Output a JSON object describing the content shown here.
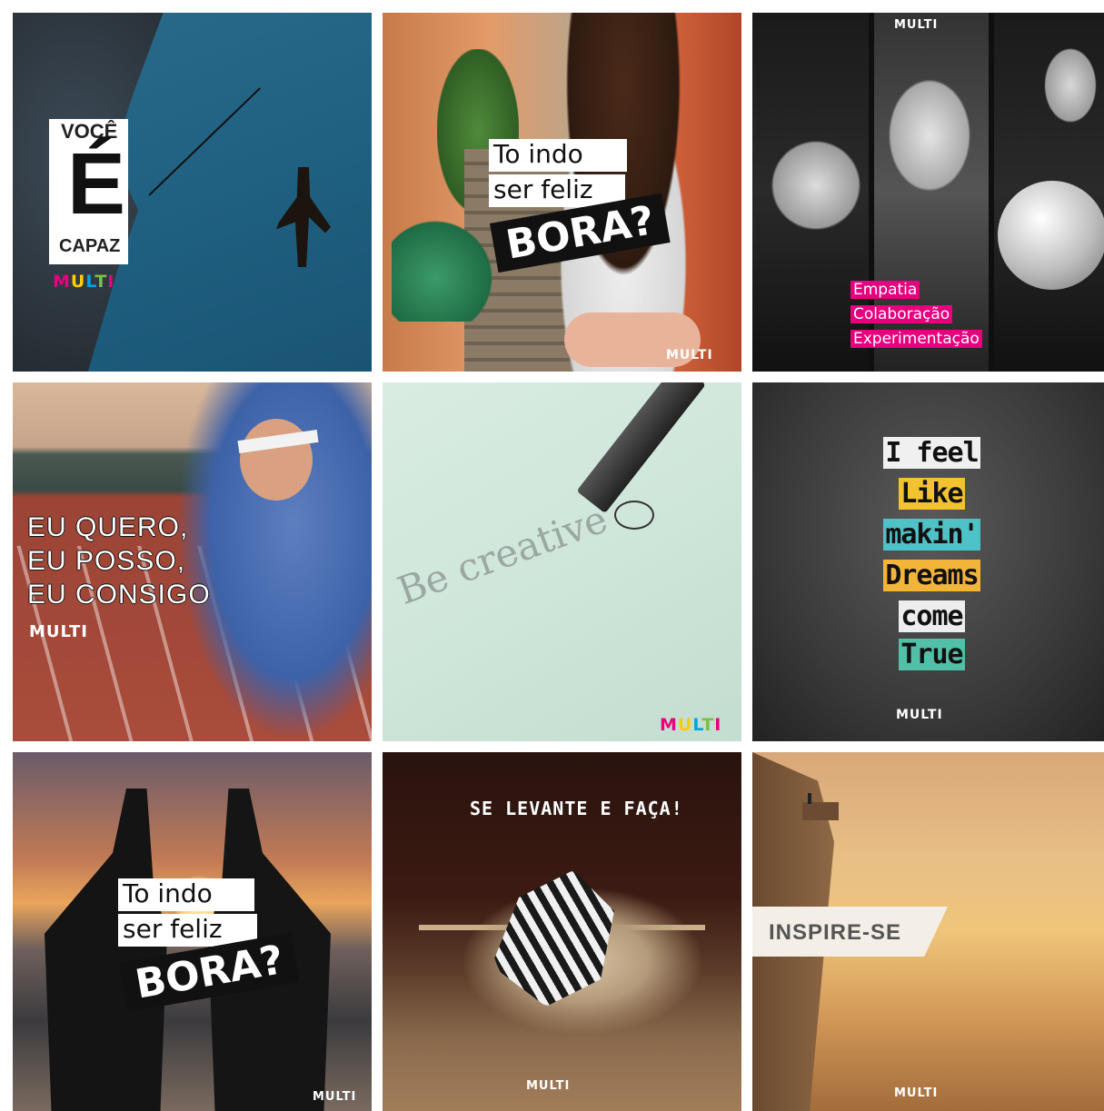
{
  "tiles": [
    {
      "id": "voce-e-capaz",
      "line1": "VOCÊ",
      "big": "É",
      "line2": "CAPAZ",
      "logo": "MULTI"
    },
    {
      "id": "to-indo-street",
      "line1": "To indo",
      "line2": "ser feliz",
      "cta": "BORA?",
      "logo": "MULTI"
    },
    {
      "id": "hands",
      "tags": [
        "Empatia",
        "Colaboração",
        "Experimentação"
      ],
      "logo": "MULTI"
    },
    {
      "id": "runner",
      "lines": [
        "EU QUERO,",
        "EU POSSO,",
        "EU CONSIGO"
      ],
      "logo": "MULTI"
    },
    {
      "id": "be-creative",
      "text": "Be creative",
      "logo": "MULTI"
    },
    {
      "id": "dreams",
      "rows": [
        "I feel",
        "Like",
        "makin'",
        "Dreams",
        "come",
        "True"
      ],
      "logo": "MULTI"
    },
    {
      "id": "to-indo-sunset",
      "line1": "To indo",
      "line2": "ser feliz",
      "cta": "BORA?",
      "logo": "MULTI"
    },
    {
      "id": "zebra",
      "title": "SE LEVANTE E FAÇA!",
      "logo": "MULTI"
    },
    {
      "id": "cliff",
      "title": "INSPIRE-SE",
      "logo": "MULTI"
    }
  ],
  "colors": {
    "brand_pink": "#e6007e",
    "brand_yellow": "#ffcc00",
    "brand_blue": "#00a3e0",
    "brand_green": "#7ac143"
  }
}
